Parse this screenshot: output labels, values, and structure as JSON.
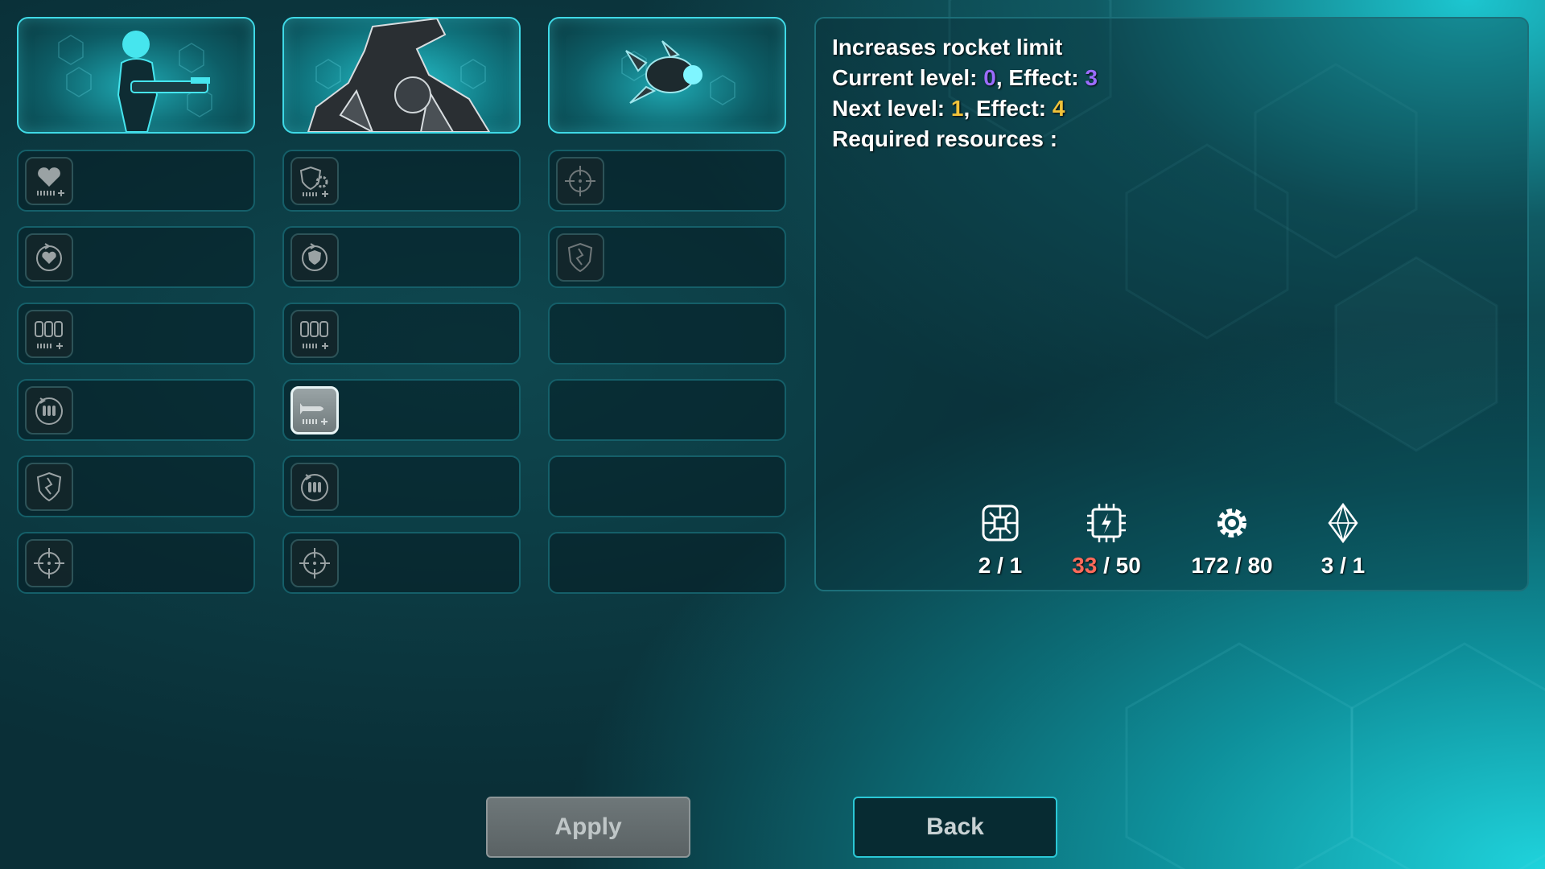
{
  "characters": [
    {
      "name": "soldier",
      "icon": "soldier-portrait"
    },
    {
      "name": "mech",
      "icon": "mech-portrait"
    },
    {
      "name": "drone",
      "icon": "drone-portrait"
    }
  ],
  "selected_character": 1,
  "columns": [
    {
      "slots": [
        "heart-plus-icon",
        "heart-regen-icon",
        "ammo-plus-icon",
        "ammo-reload-icon",
        "armor-break-icon",
        "crosshair-icon"
      ]
    },
    {
      "slots": [
        "shield-gear-icon",
        "shield-regen-icon",
        "ammo-plus-icon",
        "rocket-plus-icon",
        "ammo-reload-icon",
        "crosshair-icon"
      ]
    },
    {
      "slots": [
        "crosshair-icon",
        "armor-break-icon",
        "",
        "",
        "",
        ""
      ]
    }
  ],
  "active_slot": {
    "column": 1,
    "row": 3
  },
  "info": {
    "title": "Increases rocket limit",
    "current_label": "Current level:",
    "current_level": "0",
    "current_effect_label": "Effect:",
    "current_effect": "3",
    "next_label": "Next level:",
    "next_level": "1",
    "next_effect_label": "Effect:",
    "next_effect": "4",
    "required_label": "Required resources :"
  },
  "resources": [
    {
      "icon": "circuit-board-icon",
      "have": "2",
      "need": "1",
      "short": false
    },
    {
      "icon": "power-chip-icon",
      "have": "33",
      "need": "50",
      "short": true
    },
    {
      "icon": "gear-icon",
      "have": "172",
      "need": "80",
      "short": false
    },
    {
      "icon": "crystal-icon",
      "have": "3",
      "need": "1",
      "short": false
    }
  ],
  "buttons": {
    "apply": "Apply",
    "back": "Back"
  },
  "colors": {
    "accent": "#3fd9e6",
    "purple": "#9b6cff",
    "yellow": "#f0c23a",
    "shortage": "#ff6a5a"
  }
}
